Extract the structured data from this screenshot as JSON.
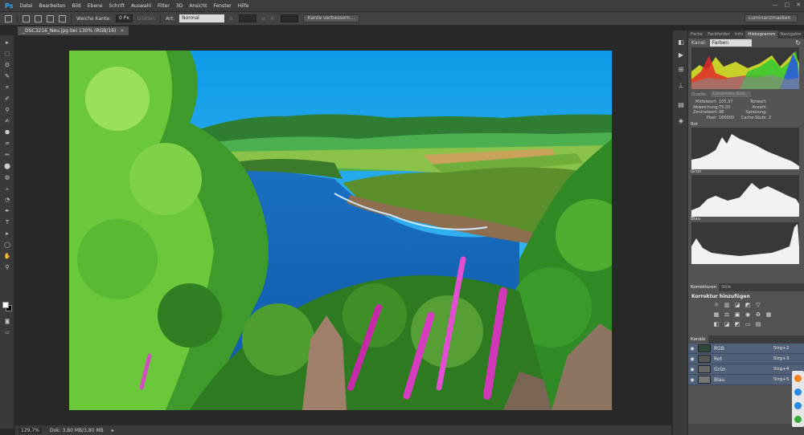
{
  "menubar": {
    "logo": "Ps",
    "items": [
      "Datei",
      "Bearbeiten",
      "Bild",
      "Ebene",
      "Schrift",
      "Auswahl",
      "Filter",
      "3D",
      "Ansicht",
      "Fenster",
      "Hilfe"
    ],
    "window_controls": [
      "—",
      "□",
      "✕"
    ]
  },
  "options": {
    "soft_edge_label": "Weiche Kante:",
    "soft_edge_value": "0 Px",
    "smoothing_label": "Glätten",
    "style_label": "Art:",
    "style_value": "Normal",
    "width_label": "B:",
    "height_label": "H:",
    "refine_label": "Kante verbessern...",
    "workspace_value": "Luminanzmasken"
  },
  "document": {
    "tab_title": "_DSC3216_Neu.jpg bei 130% (RGB/16)",
    "tab_close": "×",
    "zoom": "129,7%",
    "doc_info": "Dok: 3,80 MB/3,80 MB",
    "status_arrow": "▸"
  },
  "tools": [
    "▸",
    "⬚",
    "ʘ",
    "✎",
    "⌗",
    "✐",
    "⚲",
    "✍",
    "⬣",
    "♒",
    "✏",
    "⬤",
    "◍",
    "▵",
    "◔",
    "✒",
    "T",
    "▸",
    "◯",
    "✋",
    "⚲"
  ],
  "dock_icons": [
    "◧",
    "▶",
    "⊞",
    "⊥",
    "▤",
    "◈"
  ],
  "panel": {
    "tabs": [
      "Farbe",
      "Farbfelder",
      "Info",
      "Histogramm",
      "Navigator"
    ],
    "active_tab": "Histogramm",
    "channel_label": "Kanal:",
    "channel_value": "Farben",
    "refresh_icon": "↻",
    "source_label": "Quelle:",
    "source_value": "Gesamtes Bild",
    "stats_left": [
      {
        "k": "Mittelwert:",
        "v": "105,37"
      },
      {
        "k": "Abweichung:",
        "v": "75,03"
      },
      {
        "k": "Zentralwert:",
        "v": "98"
      },
      {
        "k": "Pixel:",
        "v": "166000"
      }
    ],
    "stats_right": [
      {
        "k": "Tonwert:",
        "v": ""
      },
      {
        "k": "Anzahl:",
        "v": ""
      },
      {
        "k": "Spreizung:",
        "v": ""
      },
      {
        "k": "Cache-Stufe:",
        "v": "2"
      }
    ],
    "channels": [
      "Rot",
      "Grün",
      "Blau"
    ],
    "korrektur_tabs": [
      "Korrekturen",
      "Stile"
    ],
    "korrektur_title": "Korrektur hinzufügen",
    "korrektur_icons": [
      "☼",
      "▥",
      "◪",
      "◩",
      "▽",
      "",
      "▦",
      "⚖",
      "▣",
      "◉",
      "♻",
      "▦",
      "◧",
      "◪",
      "◩",
      "▭",
      "▤"
    ],
    "kanaele_tab": "Kanäle",
    "kanaele": [
      {
        "name": "RGB",
        "key": "Strg+2",
        "thumb": "#2e4a3a"
      },
      {
        "name": "Rot",
        "key": "Strg+3",
        "thumb": "#555"
      },
      {
        "name": "Grün",
        "key": "Strg+4",
        "thumb": "#666"
      },
      {
        "name": "Blau",
        "key": "Strg+5",
        "thumb": "#777"
      }
    ],
    "eye_icon": "◉"
  },
  "colors": {
    "accent": "#31a8ff",
    "channel_row": "#4f6078",
    "sky": "#1aa6f0",
    "sea": "#1467b8"
  }
}
